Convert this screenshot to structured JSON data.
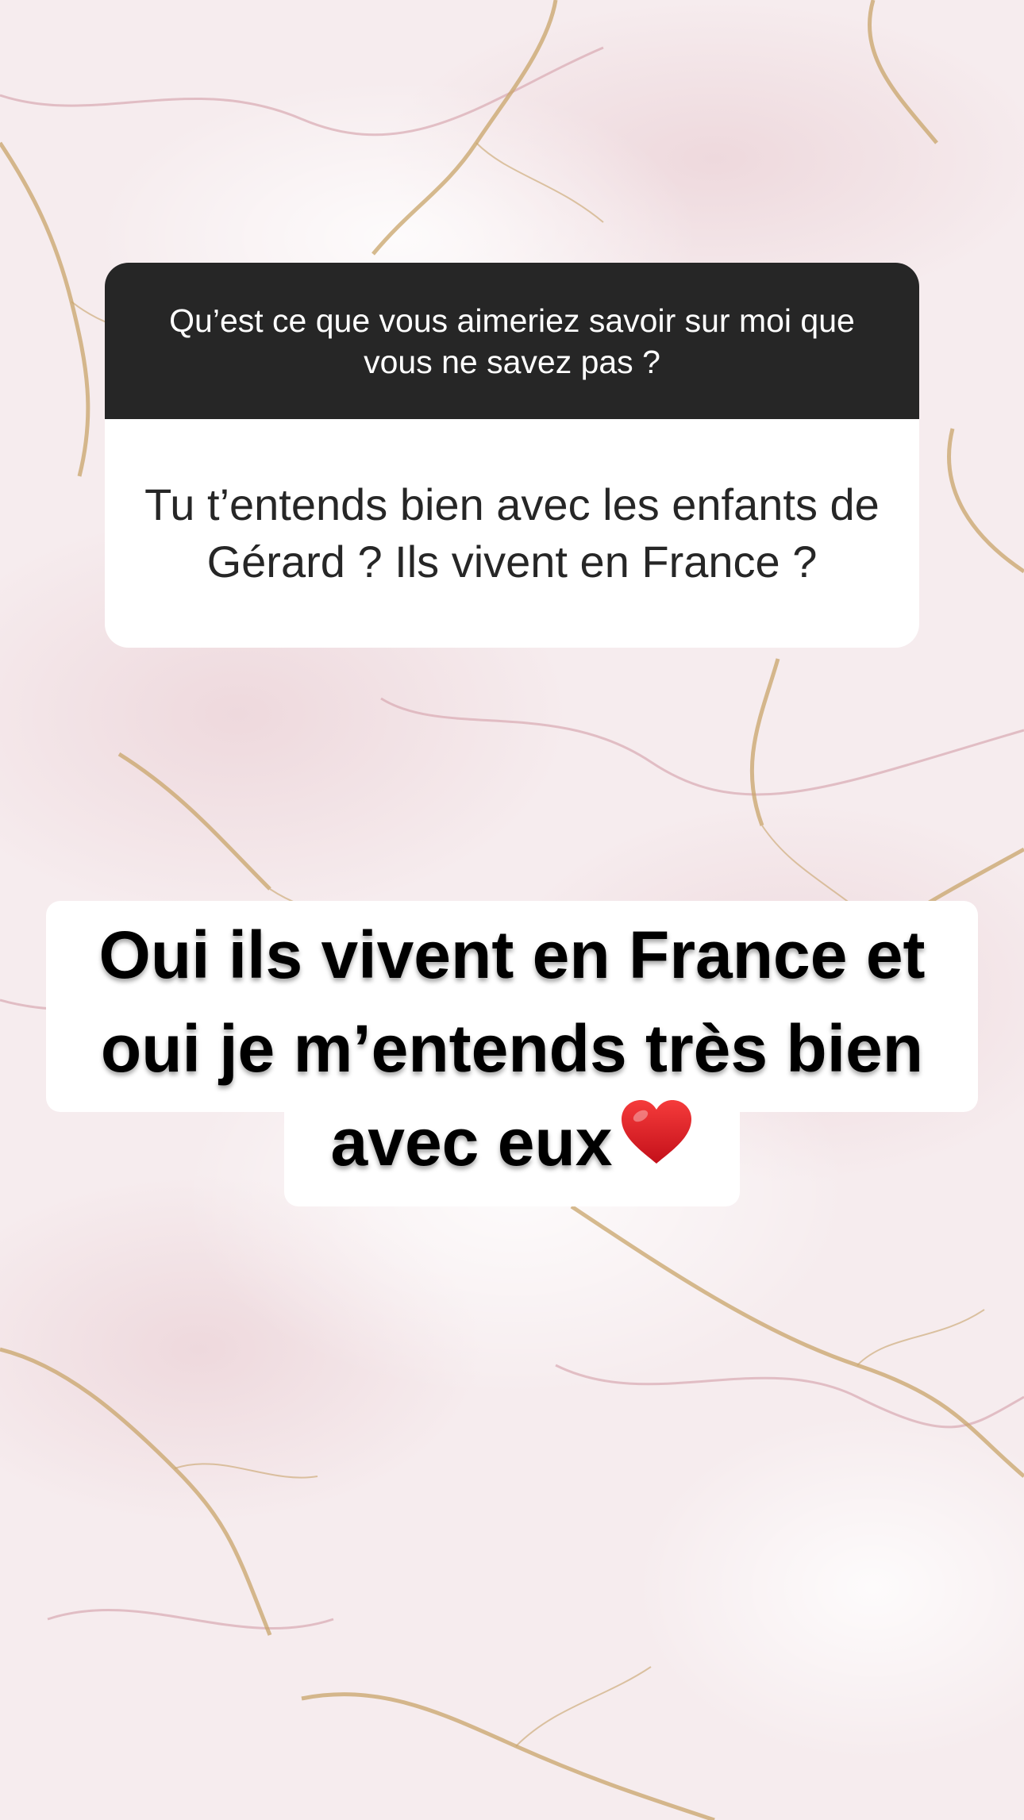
{
  "question_sticker": {
    "prompt": "Qu’est ce que vous aimeriez savoir sur moi que vous ne savez pas ?",
    "response": "Tu t’entends bien avec les enfants de Gérard ? Ils vivent en France ?",
    "header_color": "#262626",
    "body_color": "#ffffff"
  },
  "answer": {
    "line1": "Oui ils vivent en France et",
    "line2": "oui je m’entends très bien",
    "line3": "avec eux",
    "emoji": "heart-icon",
    "text_color": "#000000",
    "background_color": "#ffffff"
  },
  "background": {
    "style": "pink-gold-marble",
    "base_color": "#f7eeee",
    "vein_gold": "#c8a46a",
    "vein_pink": "#d9a9b2"
  }
}
